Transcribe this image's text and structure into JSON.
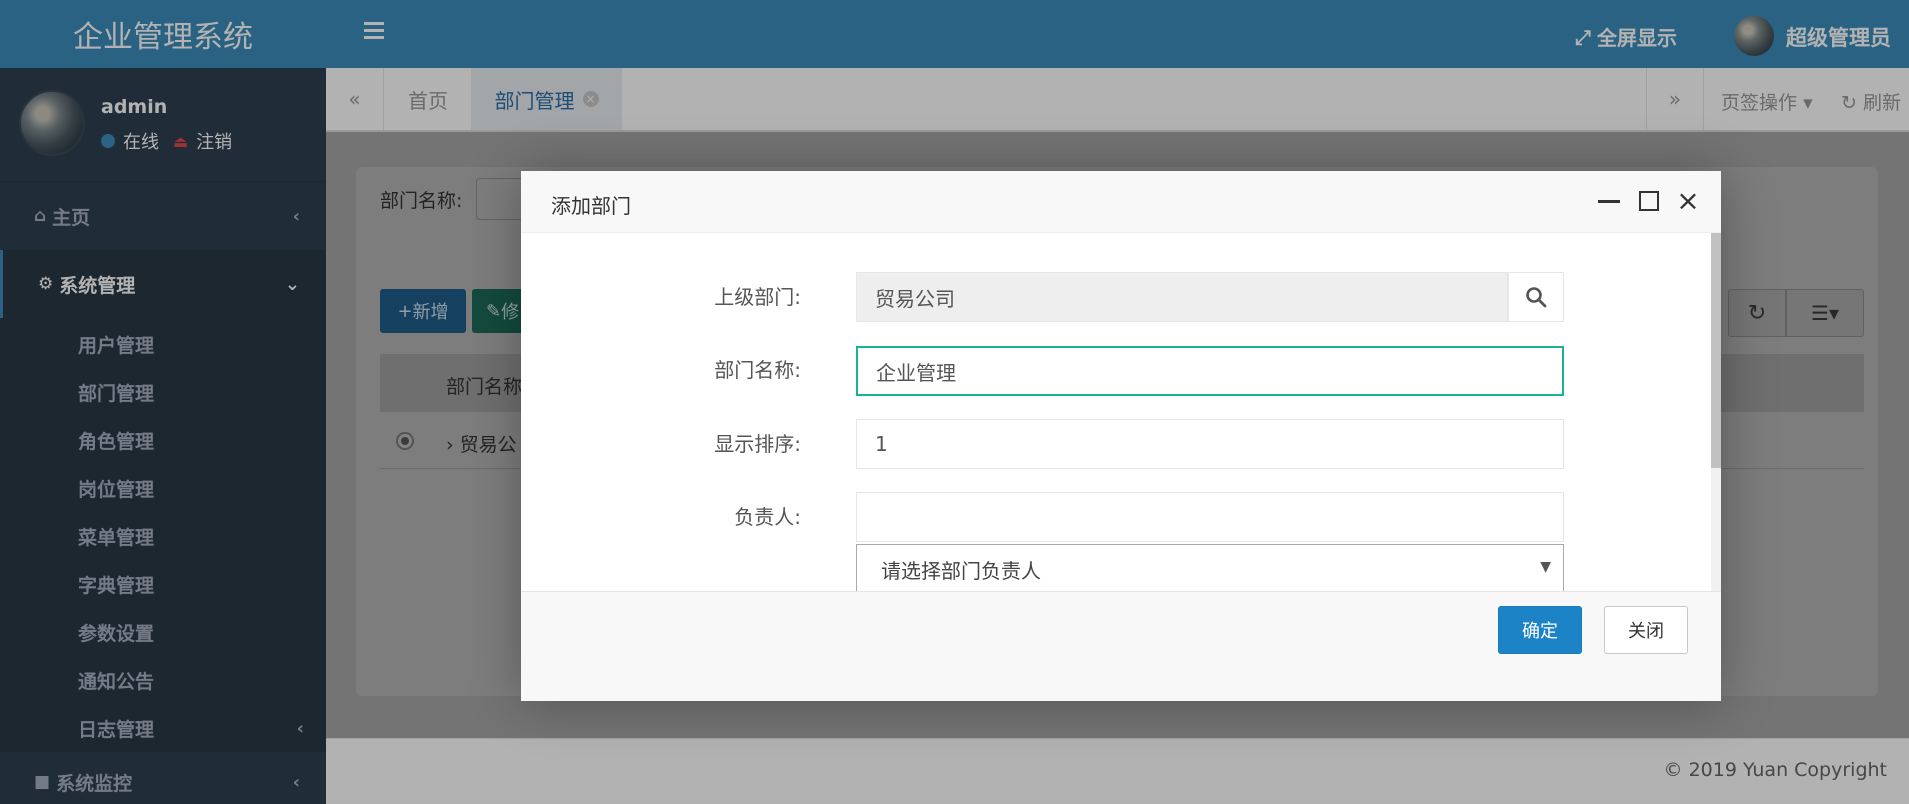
{
  "app": {
    "brand": "企业管理系统"
  },
  "user_panel": {
    "name": "admin",
    "status": "在线",
    "logout": "注销"
  },
  "sidebar": {
    "items": [
      {
        "label": "主页",
        "icon": "home-icon"
      },
      {
        "label": "系统管理",
        "icon": "gear-icon",
        "expanded": true
      },
      {
        "label": "系统监控",
        "icon": "video-icon"
      }
    ],
    "submenu": [
      {
        "label": "用户管理"
      },
      {
        "label": "部门管理"
      },
      {
        "label": "角色管理"
      },
      {
        "label": "岗位管理"
      },
      {
        "label": "菜单管理"
      },
      {
        "label": "字典管理"
      },
      {
        "label": "参数设置"
      },
      {
        "label": "通知公告"
      },
      {
        "label": "日志管理"
      }
    ]
  },
  "header": {
    "fullscreen": "全屏显示",
    "admin_name": "超级管理员"
  },
  "tabs": {
    "home": "首页",
    "active": "部门管理",
    "ops": "页签操作",
    "refresh": "刷新"
  },
  "content": {
    "search_label": "部门名称:",
    "add_button": "新增",
    "edit_button": "修",
    "table_header": "部门名称",
    "table_row": "贸易公"
  },
  "footer": {
    "copyright": "© 2019 Yuan Copyright"
  },
  "modal": {
    "title": "添加部门",
    "fields": {
      "parent": {
        "label": "上级部门:",
        "value": "贸易公司"
      },
      "name": {
        "label": "部门名称:",
        "value": "企业管理"
      },
      "order": {
        "label": "显示排序:",
        "value": "1"
      },
      "leader": {
        "label": "负责人:",
        "value": "",
        "select_placeholder": "请选择部门负责人"
      }
    },
    "confirm": "确定",
    "cancel": "关闭"
  },
  "colors": {
    "header_blue": "#3c8dbc",
    "sidebar_dark": "#2f4050",
    "focus_green": "#1ab394",
    "primary_button": "#1c84c6"
  }
}
